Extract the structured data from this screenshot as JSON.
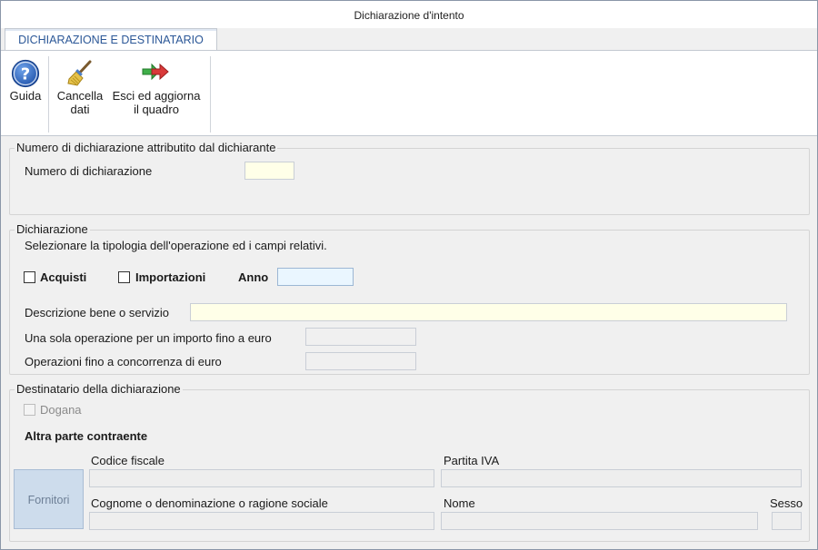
{
  "window": {
    "title": "Dichiarazione d'intento"
  },
  "tabs": [
    {
      "label": "DICHIARAZIONE E DESTINATARIO",
      "active": true
    }
  ],
  "ribbon": {
    "buttons": [
      {
        "label": "Guida",
        "icon": "help-icon"
      },
      {
        "label_line1": "Cancella",
        "label_line2": "dati",
        "icon": "broom-icon"
      },
      {
        "label_line1": "Esci ed aggiorna",
        "label_line2": "il quadro",
        "icon": "exit-arrow-icon"
      }
    ]
  },
  "section_numero": {
    "legend": "Numero di dichiarazione attributito dal dichiarante",
    "numero_label": "Numero di dichiarazione",
    "numero_value": ""
  },
  "section_dichiarazione": {
    "legend": "Dichiarazione",
    "instruction": "Selezionare la tipologia dell'operazione ed i campi relativi.",
    "acquisti_label": "Acquisti",
    "acquisti_checked": false,
    "importazioni_label": "Importazioni",
    "importazioni_checked": false,
    "anno_label": "Anno",
    "anno_value": "",
    "descrizione_label": "Descrizione bene o servizio",
    "descrizione_value": "",
    "una_sola_label": "Una sola operazione per un importo fino a euro",
    "una_sola_value": "",
    "concorrenza_label": "Operazioni fino a concorrenza di euro",
    "concorrenza_value": ""
  },
  "section_destinatario": {
    "legend": "Destinatario della dichiarazione",
    "dogana_label": "Dogana",
    "dogana_checked": false,
    "altra_parte_label": "Altra parte contraente",
    "fornitori_label": "Fornitori",
    "codice_fiscale_label": "Codice fiscale",
    "codice_fiscale_value": "",
    "partita_iva_label": "Partita IVA",
    "partita_iva_value": "",
    "cognome_label": "Cognome o denominazione o ragione sociale",
    "cognome_value": "",
    "nome_label": "Nome",
    "nome_value": "",
    "sesso_label": "Sesso",
    "sesso_value": ""
  },
  "colors": {
    "accent": "#2b5797",
    "yellow_field": "#ffffe8",
    "blue_field": "#eaf6ff",
    "button_disabled": "#cddcec"
  }
}
